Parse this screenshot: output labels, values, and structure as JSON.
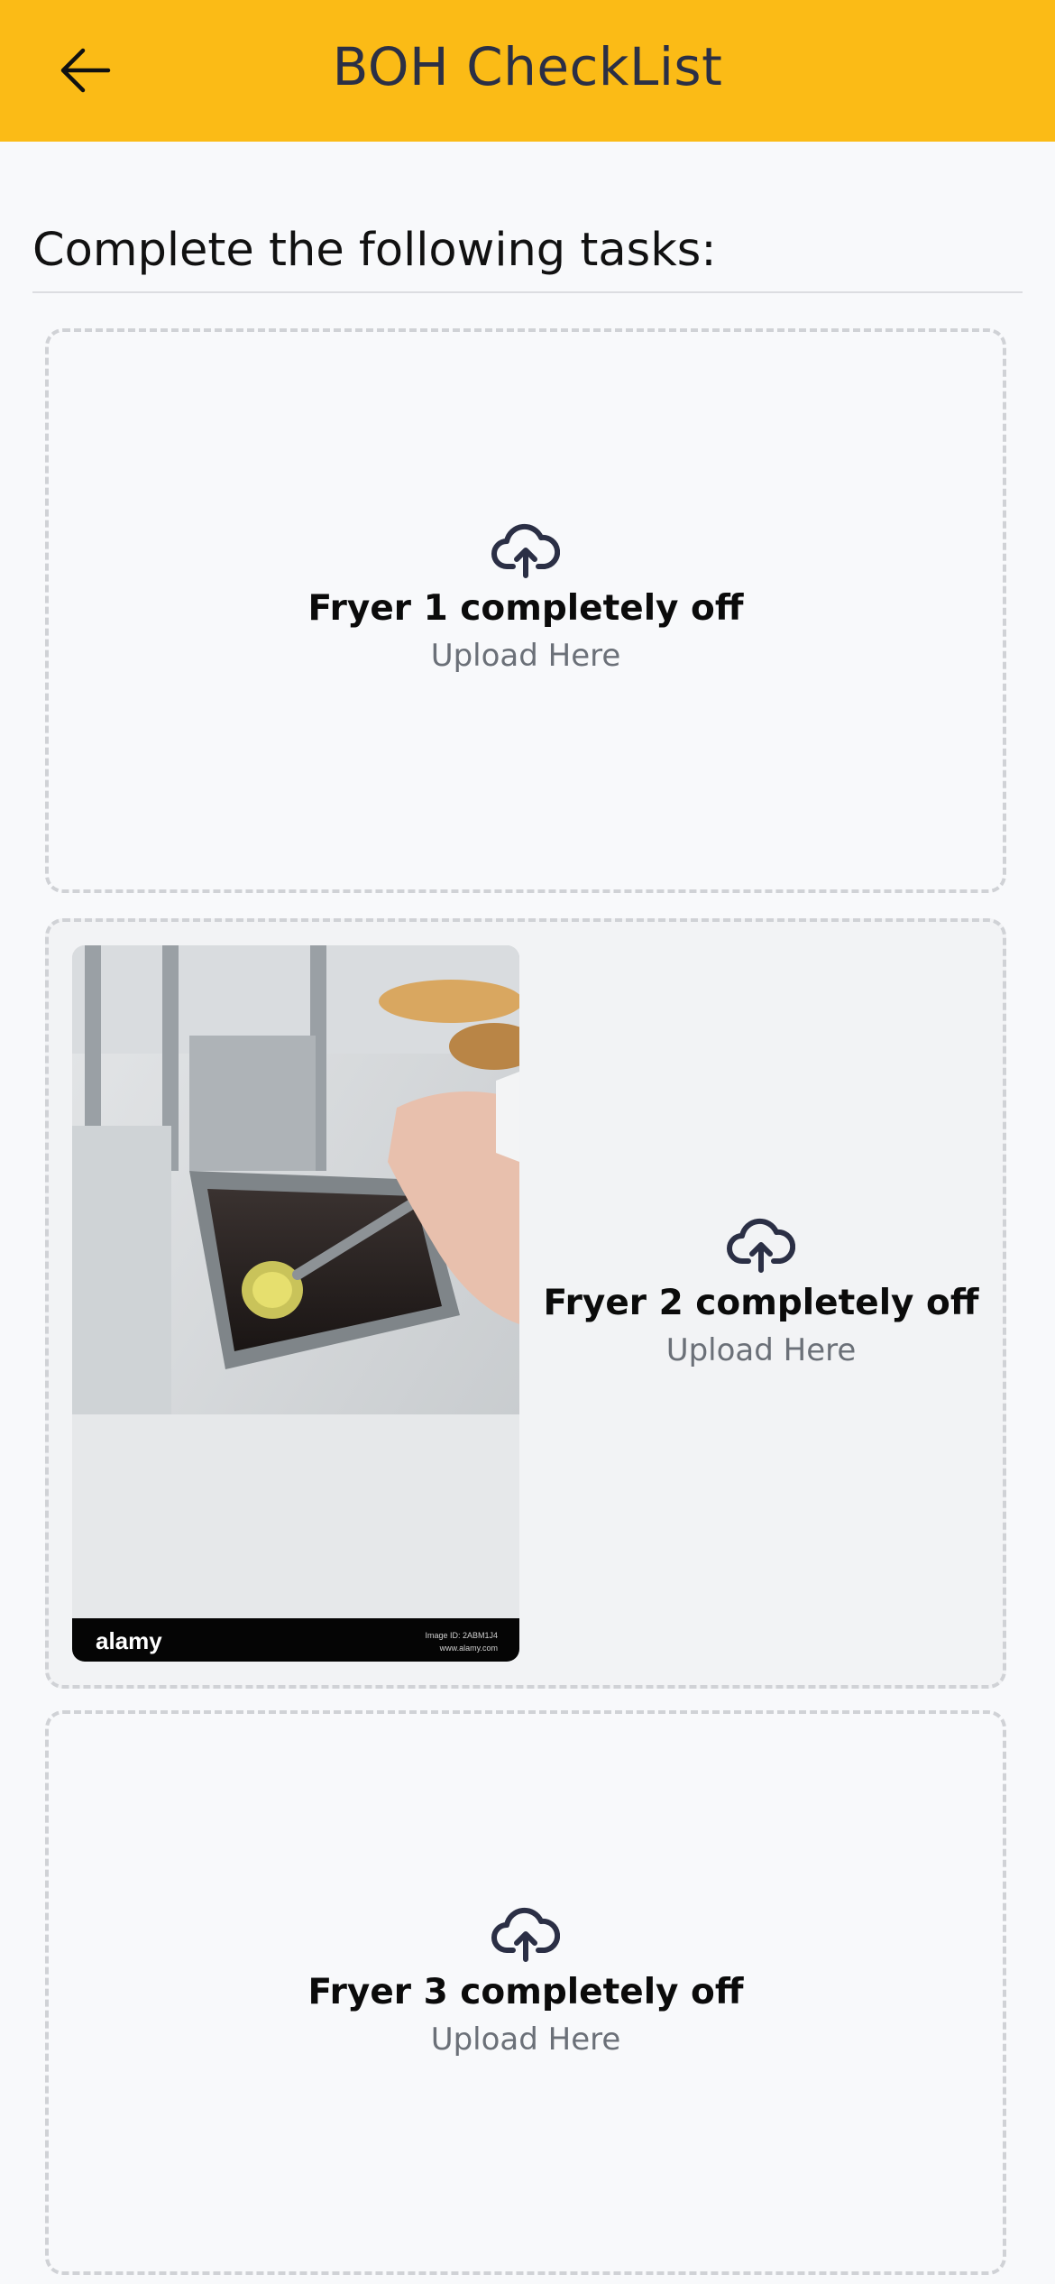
{
  "header": {
    "title": "BOH CheckList",
    "back_icon": "arrow-left-icon",
    "background_color": "#fbbb16"
  },
  "main": {
    "heading": "Complete the following tasks:",
    "tasks": [
      {
        "title": "Fryer 1 completely off",
        "hint": "Upload Here",
        "icon": "cloud-upload-icon",
        "has_photo": false
      },
      {
        "title": "Fryer 2 completely off",
        "hint": "Upload Here",
        "icon": "cloud-upload-icon",
        "has_photo": true,
        "photo": {
          "watermark": "alamy",
          "site": "www.alamy.com",
          "image_id": "Image ID: 2ABM1J4"
        }
      },
      {
        "title": "Fryer 3 completely off",
        "hint": "Upload Here",
        "icon": "cloud-upload-icon",
        "has_photo": false
      }
    ]
  }
}
